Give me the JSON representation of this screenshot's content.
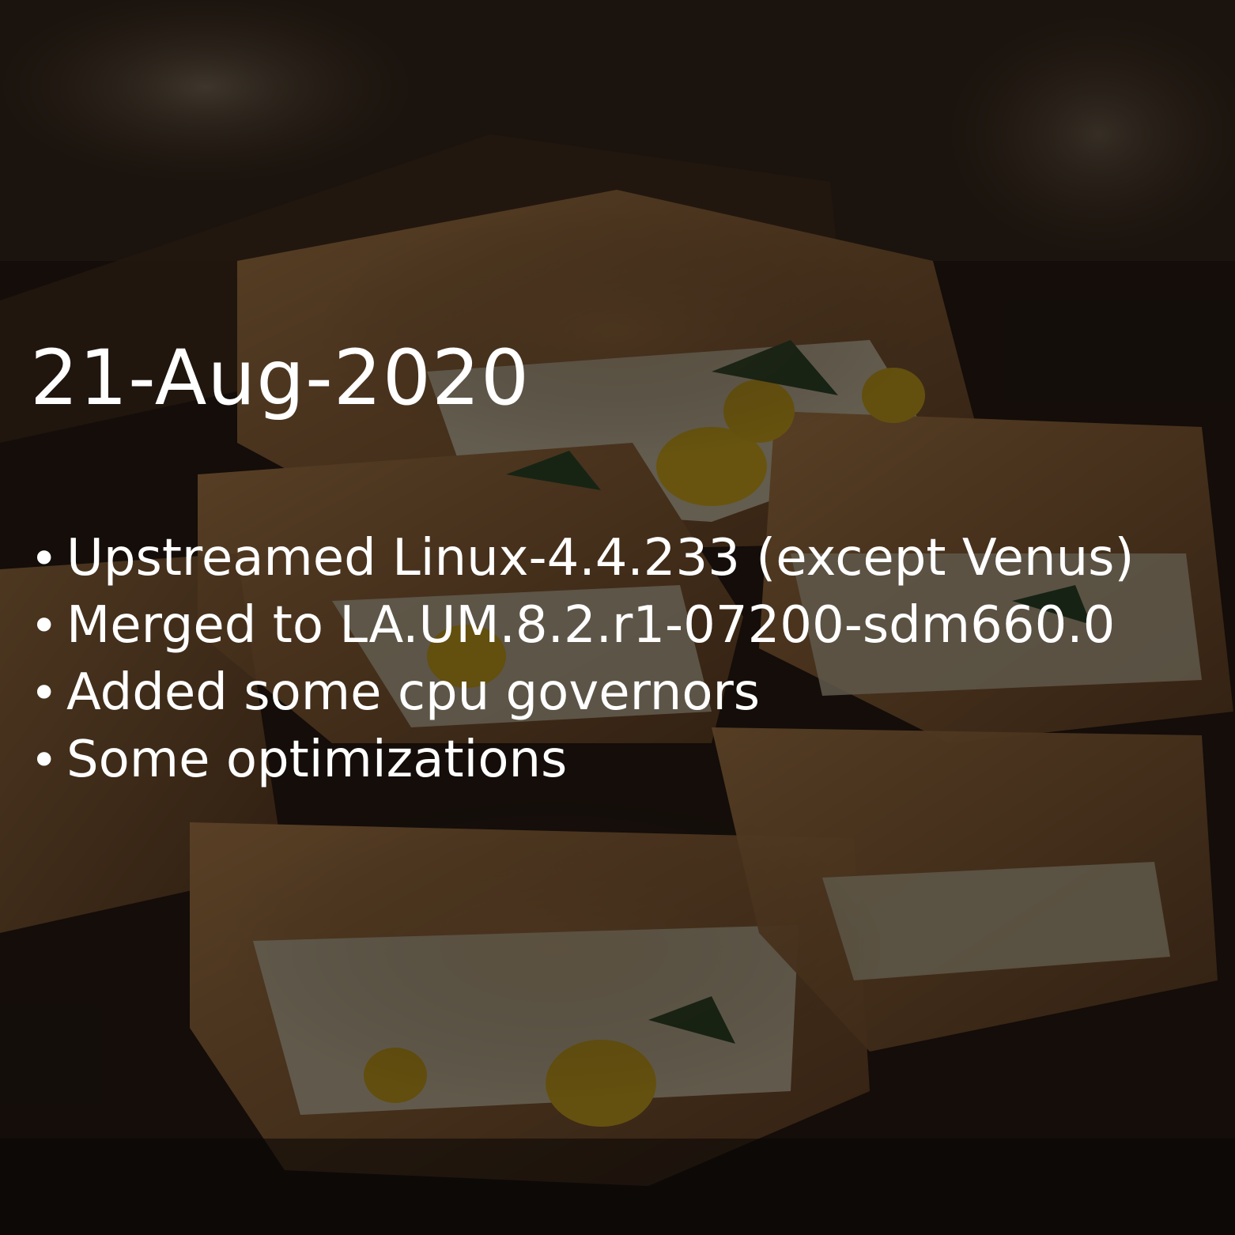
{
  "background": {
    "image": "food-photo",
    "overlay_color": "#000000"
  },
  "release": {
    "date": "21-Aug-2020",
    "bullet_glyph": "•",
    "changes": [
      "Upstreamed Linux-4.4.233 (except Venus)",
      "Merged to LA.UM.8.2.r1-07200-sdm660.0",
      "Added some cpu governors",
      "Some optimizations"
    ]
  }
}
